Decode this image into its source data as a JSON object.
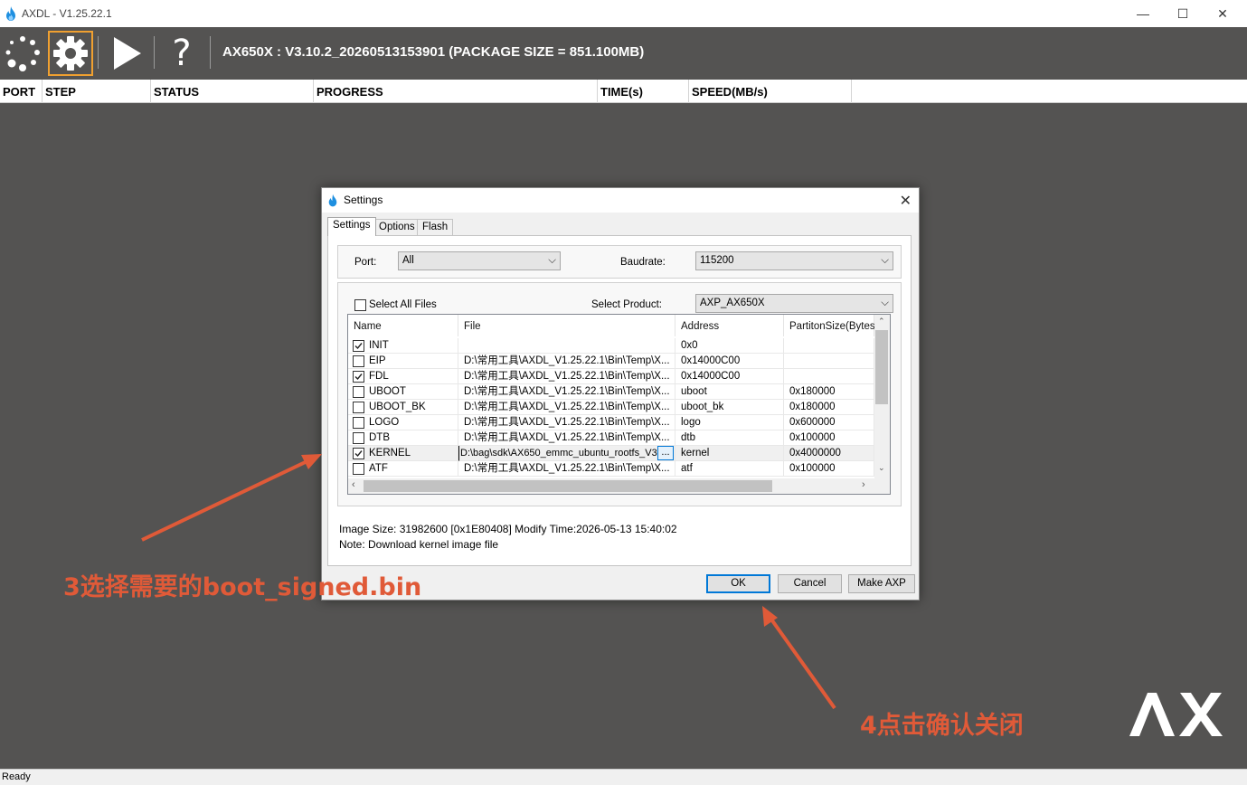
{
  "app": {
    "title": "AXDL - V1.25.22.1",
    "minimize": "—",
    "maximize": "☐",
    "close": "✕"
  },
  "toolbar": {
    "package_info": "AX650X : V3.10.2_20260513153901 (PACKAGE SIZE = 851.100MB)",
    "help": "?"
  },
  "grid": {
    "columns": [
      "PORT",
      "STEP",
      "STATUS",
      "PROGRESS",
      "TIME(s)",
      "SPEED(MB/s)"
    ]
  },
  "status": {
    "text": "Ready"
  },
  "dialog": {
    "title": "Settings",
    "close": "✕",
    "tabs": [
      "Settings",
      "Options",
      "Flash"
    ],
    "port_label": "Port:",
    "port_value": "All",
    "baudrate_label": "Baudrate:",
    "baudrate_value": "115200",
    "select_all_label": "Select All Files",
    "select_product_label": "Select Product:",
    "product_value": "AXP_AX650X",
    "table": {
      "columns": [
        "Name",
        "File",
        "Address",
        "PartitonSize(Bytes)"
      ],
      "rows": [
        {
          "checked": true,
          "name": "INIT",
          "file": "",
          "address": "0x0",
          "size": ""
        },
        {
          "checked": false,
          "name": "EIP",
          "file": "D:\\常用工具\\AXDL_V1.25.22.1\\Bin\\Temp\\X...",
          "address": "0x14000C00",
          "size": ""
        },
        {
          "checked": true,
          "name": "FDL",
          "file": "D:\\常用工具\\AXDL_V1.25.22.1\\Bin\\Temp\\X...",
          "address": "0x14000C00",
          "size": ""
        },
        {
          "checked": false,
          "name": "UBOOT",
          "file": "D:\\常用工具\\AXDL_V1.25.22.1\\Bin\\Temp\\X...",
          "address": "uboot",
          "size": "0x180000"
        },
        {
          "checked": false,
          "name": "UBOOT_BK",
          "file": "D:\\常用工具\\AXDL_V1.25.22.1\\Bin\\Temp\\X...",
          "address": "uboot_bk",
          "size": "0x180000"
        },
        {
          "checked": false,
          "name": "LOGO",
          "file": "D:\\常用工具\\AXDL_V1.25.22.1\\Bin\\Temp\\X...",
          "address": "logo",
          "size": "0x600000"
        },
        {
          "checked": false,
          "name": "DTB",
          "file": "D:\\常用工具\\AXDL_V1.25.22.1\\Bin\\Temp\\X...",
          "address": "dtb",
          "size": "0x100000"
        },
        {
          "checked": true,
          "name": "KERNEL",
          "file": "D:\\bag\\sdk\\AX650_emmc_ubuntu_rootfs_V3",
          "address": "kernel",
          "size": "0x4000000",
          "editing": true
        },
        {
          "checked": false,
          "name": "ATF",
          "file": "D:\\常用工具\\AXDL_V1.25.22.1\\Bin\\Temp\\X...",
          "address": "atf",
          "size": "0x100000"
        }
      ],
      "browse_label": "..."
    },
    "image_size": "Image Size: 31982600 [0x1E80408] Modify Time:2026-05-13 15:40:02",
    "note": "Note: Download kernel image file",
    "ok_label": "OK",
    "cancel_label": "Cancel",
    "make_axp_label": "Make AXP"
  },
  "annotations": {
    "step3": "3选择需要的boot_signed.bin",
    "step4": "4点击确认关闭",
    "color": "#e05a38"
  },
  "logo": {
    "text": "AX"
  }
}
